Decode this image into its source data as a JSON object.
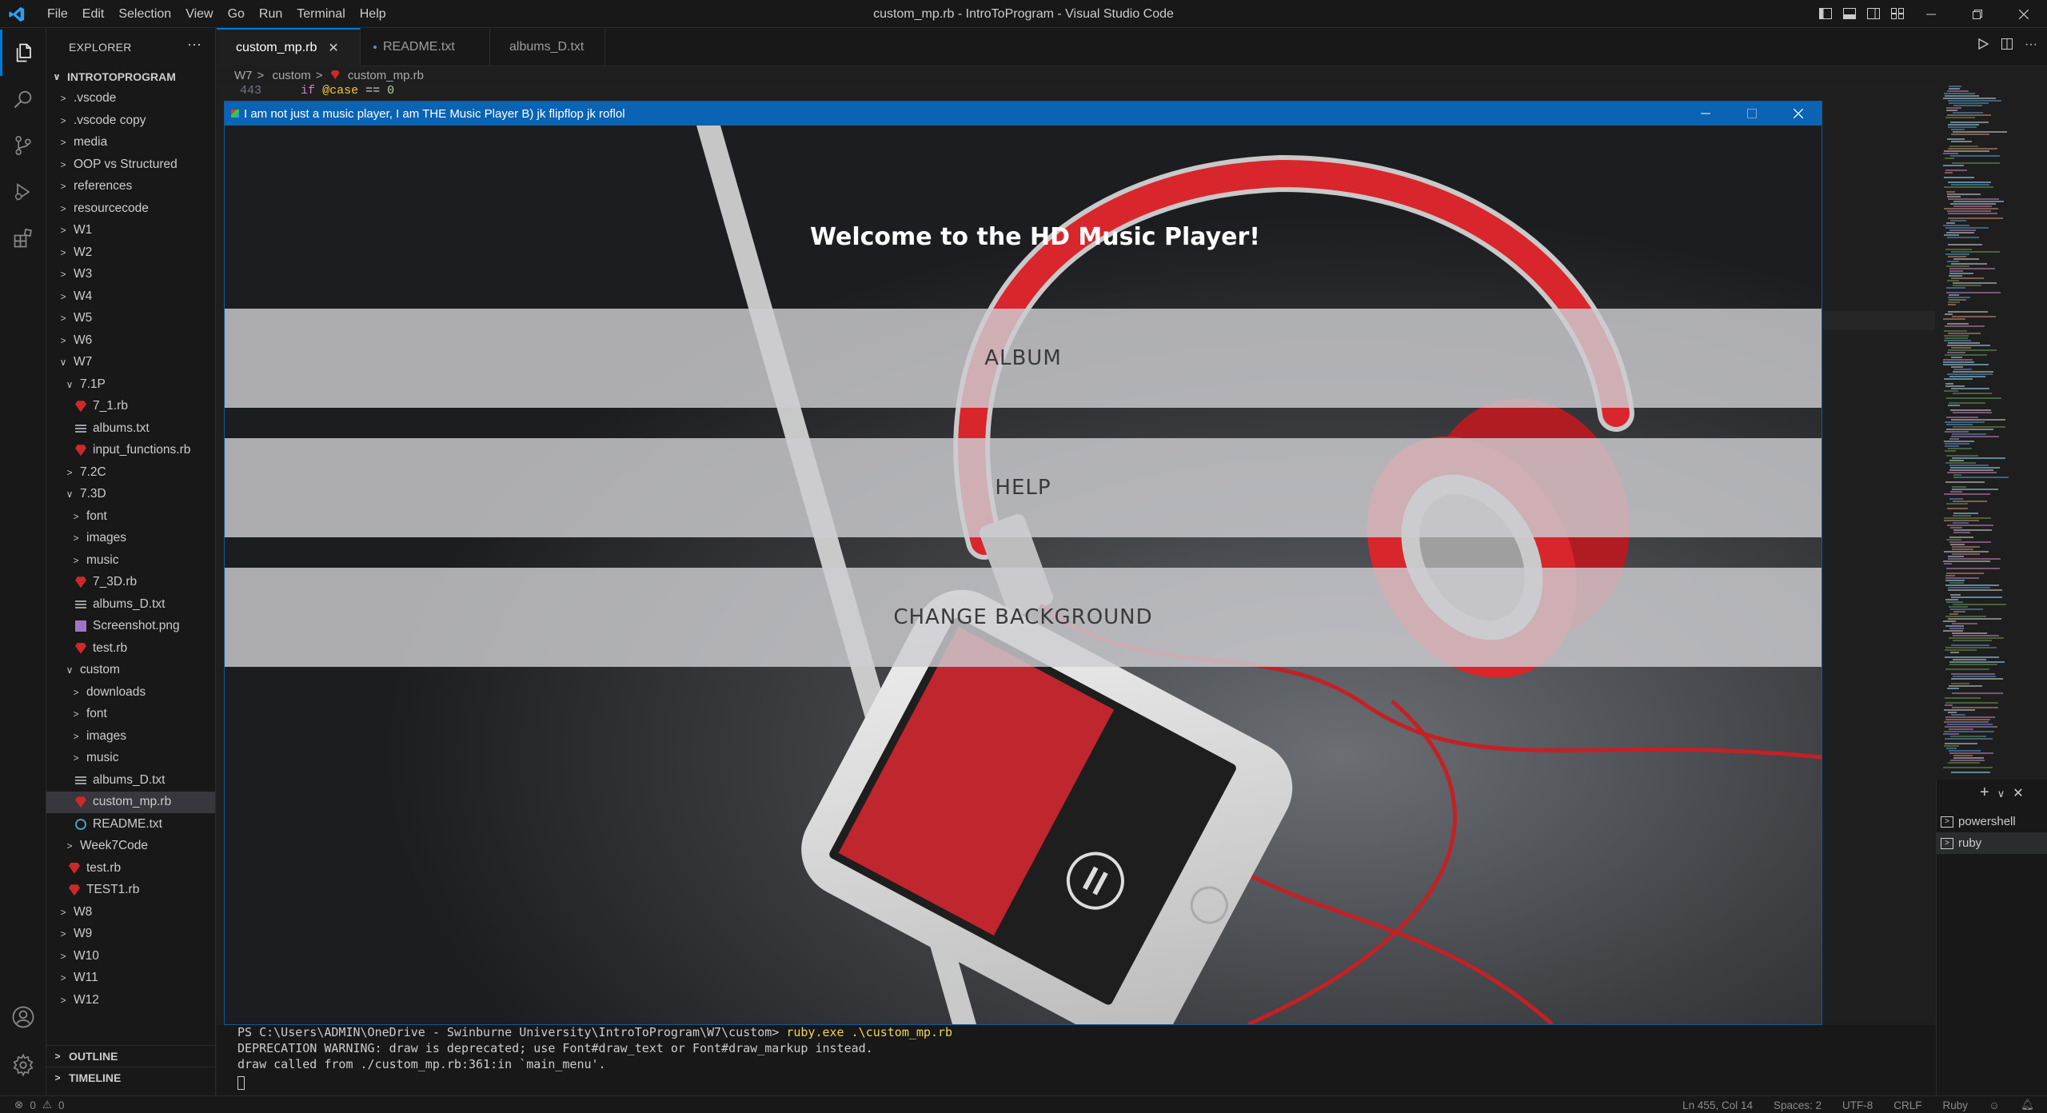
{
  "menubar": [
    "File",
    "Edit",
    "Selection",
    "View",
    "Go",
    "Run",
    "Terminal",
    "Help"
  ],
  "window_title": "custom_mp.rb - IntroToProgram - Visual Studio Code",
  "sidebar": {
    "header": "EXPLORER",
    "root": "INTROTOPROGRAM",
    "tree": [
      {
        "label": ".vscode",
        "kind": "folder",
        "depth": 1
      },
      {
        "label": ".vscode copy",
        "kind": "folder",
        "depth": 1
      },
      {
        "label": "media",
        "kind": "folder",
        "depth": 1
      },
      {
        "label": "OOP vs Structured",
        "kind": "folder",
        "depth": 1
      },
      {
        "label": "references",
        "kind": "folder",
        "depth": 1
      },
      {
        "label": "resourcecode",
        "kind": "folder",
        "depth": 1
      },
      {
        "label": "W1",
        "kind": "folder",
        "depth": 1
      },
      {
        "label": "W2",
        "kind": "folder",
        "depth": 1
      },
      {
        "label": "W3",
        "kind": "folder",
        "depth": 1
      },
      {
        "label": "W4",
        "kind": "folder",
        "depth": 1
      },
      {
        "label": "W5",
        "kind": "folder",
        "depth": 1
      },
      {
        "label": "W6",
        "kind": "folder",
        "depth": 1
      },
      {
        "label": "W7",
        "kind": "folder-open",
        "depth": 1
      },
      {
        "label": "7.1P",
        "kind": "folder-open",
        "depth": 2
      },
      {
        "label": "7_1.rb",
        "kind": "ruby",
        "depth": 3
      },
      {
        "label": "albums.txt",
        "kind": "txt",
        "depth": 3
      },
      {
        "label": "input_functions.rb",
        "kind": "ruby",
        "depth": 3
      },
      {
        "label": "7.2C",
        "kind": "folder",
        "depth": 2
      },
      {
        "label": "7.3D",
        "kind": "folder-open",
        "depth": 2
      },
      {
        "label": "font",
        "kind": "folder",
        "depth": 3
      },
      {
        "label": "images",
        "kind": "folder",
        "depth": 3
      },
      {
        "label": "music",
        "kind": "folder",
        "depth": 3
      },
      {
        "label": "7_3D.rb",
        "kind": "ruby",
        "depth": 3
      },
      {
        "label": "albums_D.txt",
        "kind": "txt",
        "depth": 3
      },
      {
        "label": "Screenshot.png",
        "kind": "png",
        "depth": 3
      },
      {
        "label": "test.rb",
        "kind": "ruby",
        "depth": 3
      },
      {
        "label": "custom",
        "kind": "folder-open",
        "depth": 2
      },
      {
        "label": "downloads",
        "kind": "folder",
        "depth": 3
      },
      {
        "label": "font",
        "kind": "folder",
        "depth": 3
      },
      {
        "label": "images",
        "kind": "folder",
        "depth": 3
      },
      {
        "label": "music",
        "kind": "folder",
        "depth": 3
      },
      {
        "label": "albums_D.txt",
        "kind": "txt",
        "depth": 3
      },
      {
        "label": "custom_mp.rb",
        "kind": "ruby",
        "depth": 3,
        "selected": true
      },
      {
        "label": "README.txt",
        "kind": "info",
        "depth": 3
      },
      {
        "label": "Week7Code",
        "kind": "folder",
        "depth": 2
      },
      {
        "label": "test.rb",
        "kind": "ruby",
        "depth": 2
      },
      {
        "label": "TEST1.rb",
        "kind": "ruby",
        "depth": 2
      },
      {
        "label": "W8",
        "kind": "folder",
        "depth": 1
      },
      {
        "label": "W9",
        "kind": "folder",
        "depth": 1
      },
      {
        "label": "W10",
        "kind": "folder",
        "depth": 1
      },
      {
        "label": "W11",
        "kind": "folder",
        "depth": 1
      },
      {
        "label": "W12",
        "kind": "folder",
        "depth": 1
      }
    ],
    "outline": "OUTLINE",
    "timeline": "TIMELINE"
  },
  "tabs": [
    {
      "label": "custom_mp.rb",
      "icon": "ruby",
      "active": true
    },
    {
      "label": "README.txt",
      "icon": "info",
      "active": false
    },
    {
      "label": "albums_D.txt",
      "icon": "txt",
      "active": false
    }
  ],
  "breadcrumb": [
    "W7",
    "custom",
    "custom_mp.rb"
  ],
  "code_line": {
    "number": "443",
    "keyword": "if",
    "var": "@case",
    "op": "==",
    "num": "0"
  },
  "app": {
    "title": "I am not just a music player, I am THE Music Player B) jk flipflop jk roflol",
    "welcome": "Welcome to the HD Music Player!",
    "buttons": [
      "ALBUM",
      "HELP",
      "CHANGE BACKGROUND"
    ]
  },
  "terminal": {
    "prompt": "PS C:\\Users\\ADMIN\\OneDrive - Swinburne University\\IntroToProgram\\W7\\custom>",
    "command": "ruby.exe .\\custom_mp.rb",
    "line2": "DEPRECATION WARNING: draw is deprecated; use Font#draw_text or Font#draw_markup instead.",
    "line3": "draw called from ./custom_mp.rb:361:in `main_menu'.",
    "sessions": [
      "powershell",
      "ruby"
    ]
  },
  "statusbar": {
    "errors": "0",
    "warnings": "0",
    "position": "Ln 455, Col 14",
    "spaces": "Spaces: 2",
    "encoding": "UTF-8",
    "eol": "CRLF",
    "language": "Ruby"
  },
  "colors": {
    "accent": "#0078d4",
    "app_titlebar": "#0b63b3",
    "headphone_red": "#d8262c"
  }
}
